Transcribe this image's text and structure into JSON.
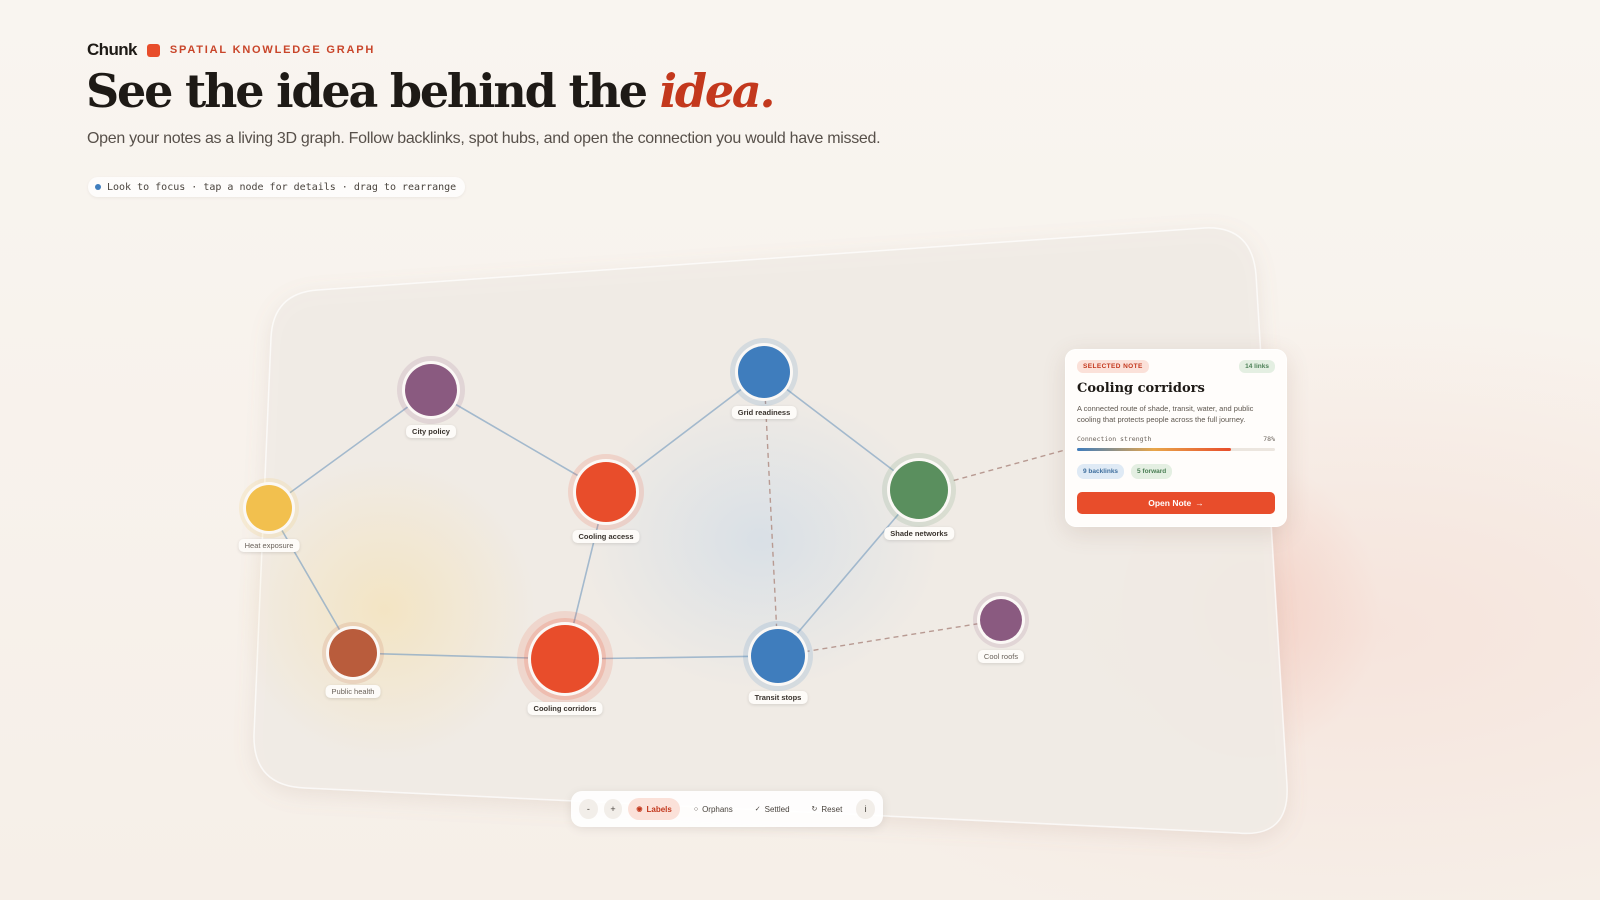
{
  "brand": {
    "name": "Chunk",
    "kicker": "SPATIAL KNOWLEDGE GRAPH",
    "accent": "#e84d2b"
  },
  "hero": {
    "title_main": "See the idea behind the ",
    "title_emph": "idea.",
    "subtitle": "Open your notes as a living 3D graph. Follow backlinks, spot hubs, and open the connection you would have missed.",
    "hint": "Look to focus · tap a node for details · drag to rearrange"
  },
  "graph": {
    "nodes": [
      {
        "label": "City policy",
        "color": "#8a5a80"
      },
      {
        "label": "Grid readiness",
        "color": "#3f7dbd"
      },
      {
        "label": "Heat exposure",
        "color": "#f2c04e"
      },
      {
        "label": "Cooling access",
        "color": "#e84d2b"
      },
      {
        "label": "Shade networks",
        "color": "#5a8f5e"
      },
      {
        "label": "Public health",
        "color": "#b95c3c"
      },
      {
        "label": "Cooling corridors",
        "color": "#e84d2b"
      },
      {
        "label": "Transit stops",
        "color": "#3f7dbd"
      },
      {
        "label": "Cool roofs",
        "color": "#8a5a80"
      }
    ]
  },
  "selected_note": {
    "tag": "SELECTED NOTE",
    "links": "14 links",
    "title": "Cooling corridors",
    "description": "A connected route of shade, transit, water, and public cooling that protects people across the full journey.",
    "strength_label": "Connection strength",
    "strength_value": "78%",
    "strength": 0.78,
    "backlinks": "9 backlinks",
    "forward": "5 forward",
    "open_label": "Open Note",
    "open_icon": "arrow-right-icon"
  },
  "toolbar": {
    "zoom_out": "-",
    "zoom_in": "+",
    "labels": "Labels",
    "orphans": "Orphans",
    "settled": "Settled",
    "reset": "Reset",
    "info": "i",
    "labels_icon": "◉",
    "orphans_icon": "○",
    "settled_icon": "✓",
    "reset_icon": "↻"
  }
}
